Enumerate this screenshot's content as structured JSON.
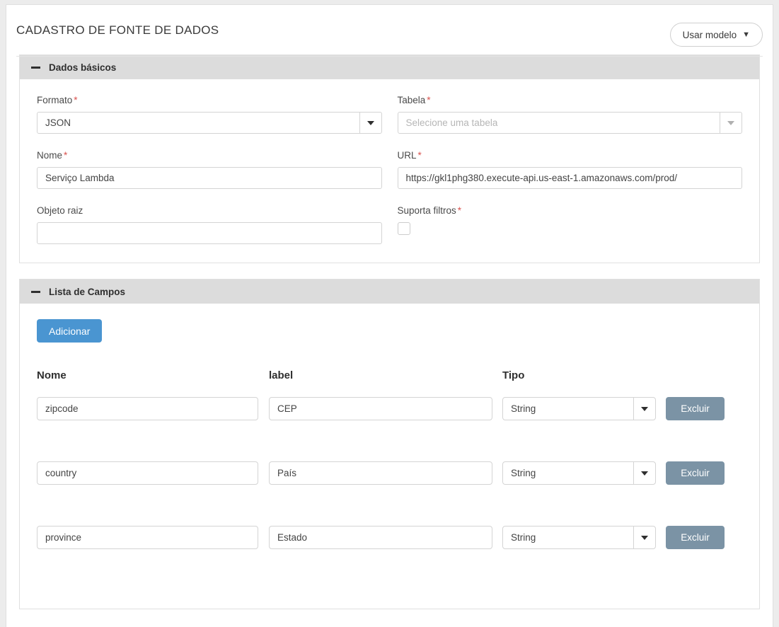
{
  "header": {
    "title": "CADASTRO DE FONTE DE DADOS",
    "template_button": "Usar modelo",
    "template_caret": "▼"
  },
  "sections": {
    "basic": {
      "title": "Dados básicos",
      "fields": {
        "formato": {
          "label": "Formato",
          "required": "*",
          "value": "JSON"
        },
        "tabela": {
          "label": "Tabela",
          "required": "*",
          "placeholder": "Selecione uma tabela",
          "value": ""
        },
        "nome": {
          "label": "Nome",
          "required": "*",
          "value": "Serviço Lambda"
        },
        "url": {
          "label": "URL",
          "required": "*",
          "value": "https://gkl1phg380.execute-api.us-east-1.amazonaws.com/prod/"
        },
        "objeto_raiz": {
          "label": "Objeto raiz",
          "required": "",
          "value": ""
        },
        "suporta_filtros": {
          "label": "Suporta filtros",
          "required": "*",
          "checked": false
        }
      }
    },
    "fields_list": {
      "title": "Lista de Campos",
      "add_button": "Adicionar",
      "columns": [
        "Nome",
        "label",
        "Tipo"
      ],
      "delete_label": "Excluir",
      "rows": [
        {
          "nome": "zipcode",
          "label": "CEP",
          "tipo": "String"
        },
        {
          "nome": "country",
          "label": "País",
          "tipo": "String"
        },
        {
          "nome": "province",
          "label": "Estado",
          "tipo": "String"
        }
      ]
    }
  },
  "colors": {
    "add_button": "#4a95d1",
    "delete_button": "#7b93a5",
    "panel_header": "#dcdcdc",
    "required_asterisk": "#d9534f",
    "page_background": "#ececec"
  }
}
